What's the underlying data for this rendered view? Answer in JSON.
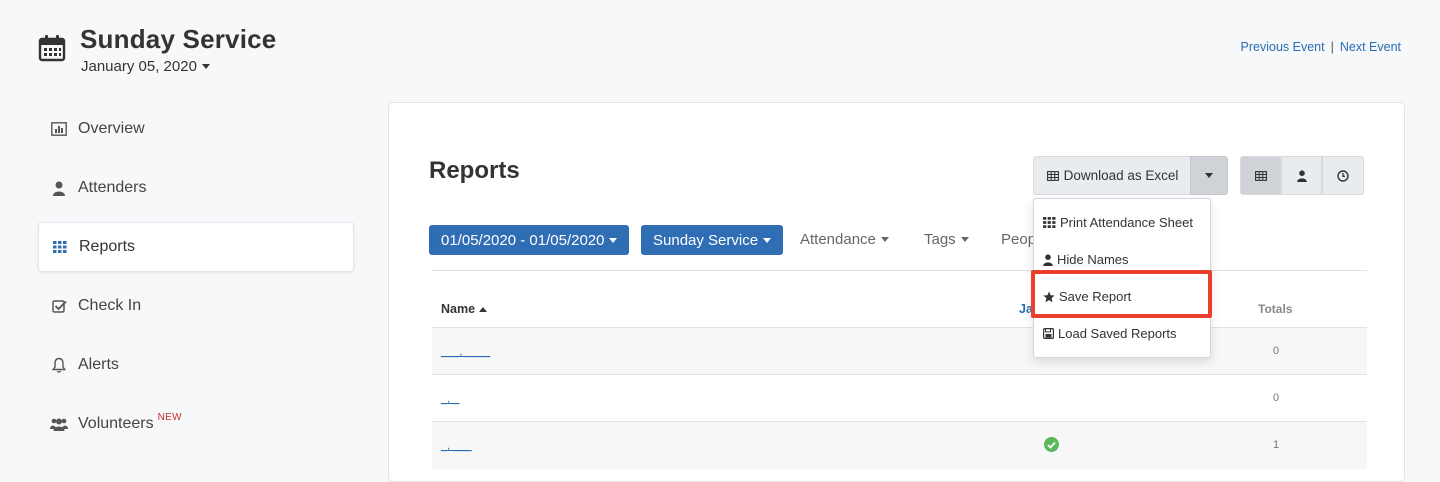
{
  "header": {
    "title": "Sunday Service",
    "date": "January 05, 2020",
    "prev_event": "Previous Event",
    "separator": "|",
    "next_event": "Next Event"
  },
  "sidebar": {
    "items": [
      {
        "label": "Overview",
        "icon": "bar-chart-icon"
      },
      {
        "label": "Attenders",
        "icon": "user-icon"
      },
      {
        "label": "Reports",
        "icon": "grid-icon",
        "active": true
      },
      {
        "label": "Check In",
        "icon": "checkbox-icon"
      },
      {
        "label": "Alerts",
        "icon": "bell-icon"
      },
      {
        "label": "Volunteers",
        "icon": "users-icon",
        "badge": "NEW"
      }
    ]
  },
  "main": {
    "title": "Reports",
    "download_label": "Download as Excel",
    "filters": {
      "date_range": "01/05/2020 - 01/05/2020",
      "event": "Sunday Service",
      "attendance": "Attendance",
      "tags": "Tags",
      "people": "Peop"
    },
    "table": {
      "col_name": "Name",
      "col_date": "Ja",
      "col_totals": "Totals",
      "rows": [
        {
          "name": "___, ____",
          "total": "0",
          "attended": false
        },
        {
          "name": "_, _",
          "total": "0",
          "attended": false
        },
        {
          "name": "_, ___",
          "total": "1",
          "attended": true
        }
      ]
    },
    "menu": {
      "items": [
        {
          "label": "Print Attendance Sheet",
          "icon": "grid-icon"
        },
        {
          "label": "Hide Names",
          "icon": "user-icon"
        },
        {
          "label": "Save Report",
          "icon": "star-icon"
        },
        {
          "label": "Load Saved Reports",
          "icon": "save-icon"
        }
      ]
    }
  },
  "colors": {
    "primary": "#2f6db5",
    "link": "#2a6db3",
    "highlight": "#e8402d",
    "success": "#5cb85c",
    "badge": "#c9302c"
  }
}
